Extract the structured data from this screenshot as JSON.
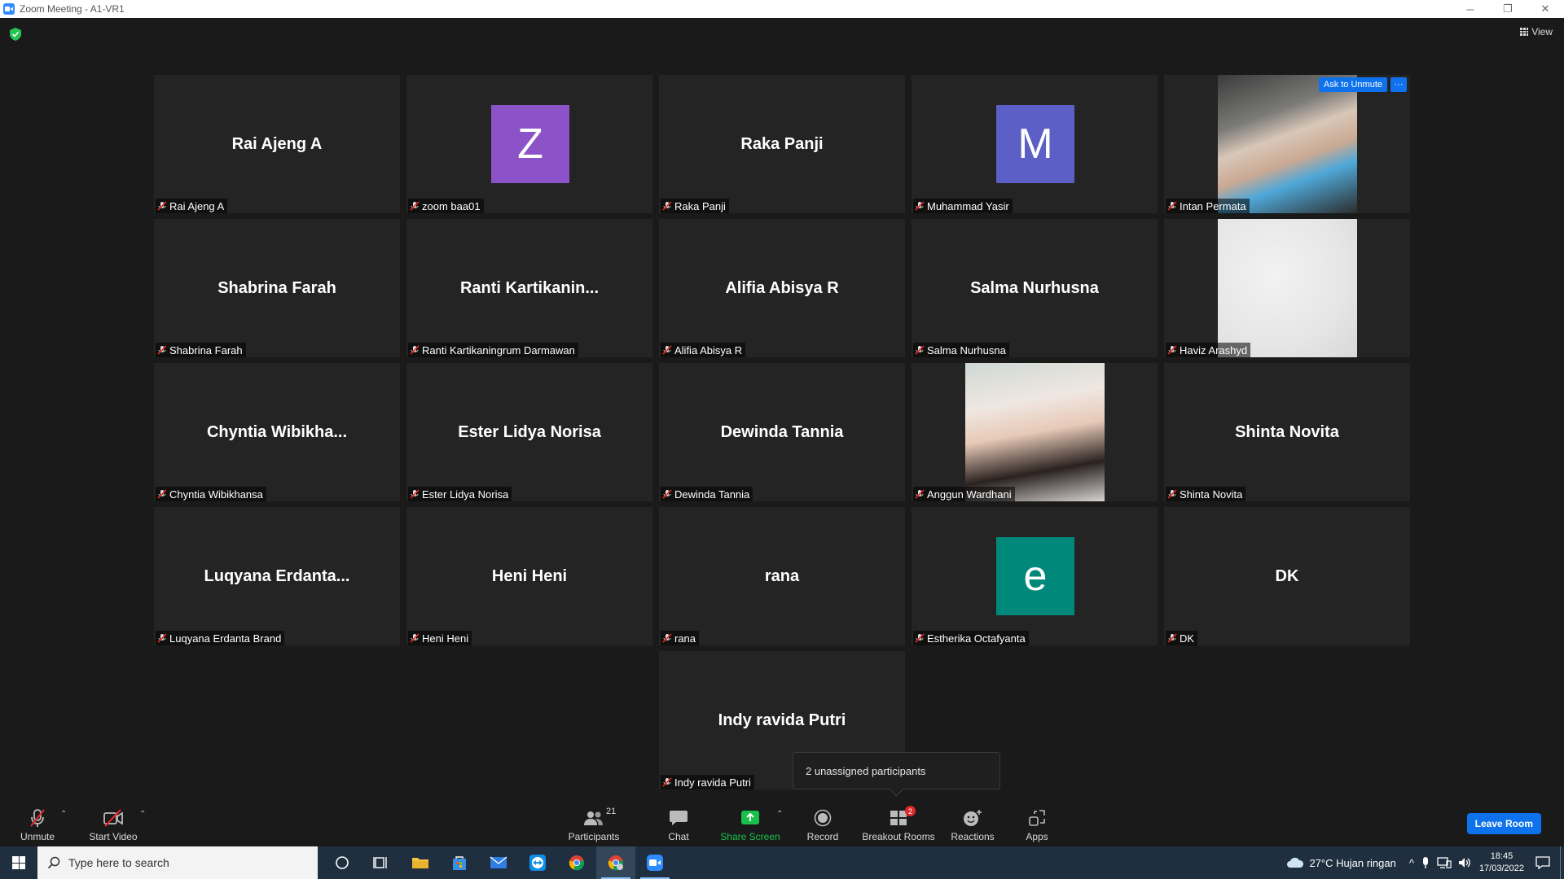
{
  "window": {
    "title": "Zoom Meeting - A1-VR1",
    "controls": {
      "minimize": "─",
      "restore": "❐",
      "close": "✕"
    }
  },
  "header": {
    "view_label": "View"
  },
  "tiles": [
    {
      "name": "Rai Ajeng A",
      "display": "Rai Ajeng A",
      "type": "name"
    },
    {
      "name": "zoom baa01",
      "display": "Z",
      "type": "avatar",
      "color": "#8c52c7"
    },
    {
      "name": "Raka Panji",
      "display": "Raka Panji",
      "type": "name"
    },
    {
      "name": "Muhammad Yasir",
      "display": "M",
      "type": "avatar",
      "color": "#5c5fc6"
    },
    {
      "name": "Intan Permata",
      "display": "",
      "type": "photo",
      "ask_unmute": "Ask to Unmute",
      "more": "···"
    },
    {
      "name": "Shabrina Farah",
      "display": "Shabrina Farah",
      "type": "name"
    },
    {
      "name": "Ranti Kartikaningrum Darmawan",
      "display": "Ranti  Kartikanin...",
      "type": "name"
    },
    {
      "name": "Alifia Abisya R",
      "display": "Alifia Abisya R",
      "type": "name"
    },
    {
      "name": "Salma Nurhusna",
      "display": "Salma Nurhusna",
      "type": "name"
    },
    {
      "name": "Haviz Arashyd",
      "display": "",
      "type": "photo"
    },
    {
      "name": "Chyntia Wibikhansa",
      "display": "Chyntia  Wibikha...",
      "type": "name"
    },
    {
      "name": "Ester Lidya Norisa",
      "display": "Ester Lidya Norisa",
      "type": "name"
    },
    {
      "name": "Dewinda Tannia",
      "display": "Dewinda Tannia",
      "type": "name"
    },
    {
      "name": "Anggun Wardhani",
      "display": "",
      "type": "photo"
    },
    {
      "name": "Shinta Novita",
      "display": "Shinta Novita",
      "type": "name"
    },
    {
      "name": "Luqyana Erdanta Brand",
      "display": "Luqyana  Erdanta...",
      "type": "name"
    },
    {
      "name": "Heni Heni",
      "display": "Heni Heni",
      "type": "name"
    },
    {
      "name": "rana",
      "display": "rana",
      "type": "name"
    },
    {
      "name": "Estherika Octafyanta",
      "display": "e",
      "type": "avatar",
      "color": "#00897b"
    },
    {
      "name": "DK",
      "display": "DK",
      "type": "name"
    },
    {
      "name": "Indy ravida Putri",
      "display": "Indy ravida Putri",
      "type": "name"
    }
  ],
  "tooltip": {
    "text": "2 unassigned participants"
  },
  "toolbar": {
    "unmute": "Unmute",
    "start_video": "Start Video",
    "participants": "Participants",
    "participants_count": "21",
    "chat": "Chat",
    "share_screen": "Share Screen",
    "record": "Record",
    "breakout_rooms": "Breakout Rooms",
    "breakout_badge": "2",
    "reactions": "Reactions",
    "apps": "Apps",
    "leave": "Leave Room",
    "caret": "⌃"
  },
  "taskbar": {
    "search_placeholder": "Type here to search",
    "weather": "27°C  Hujan ringan",
    "time": "18:45",
    "date": "17/03/2022"
  },
  "colors": {
    "accent": "#0e72ed",
    "share_green": "#19c04b",
    "mute_red": "#e02828",
    "background": "#1a1a1a",
    "tile": "#242424"
  }
}
